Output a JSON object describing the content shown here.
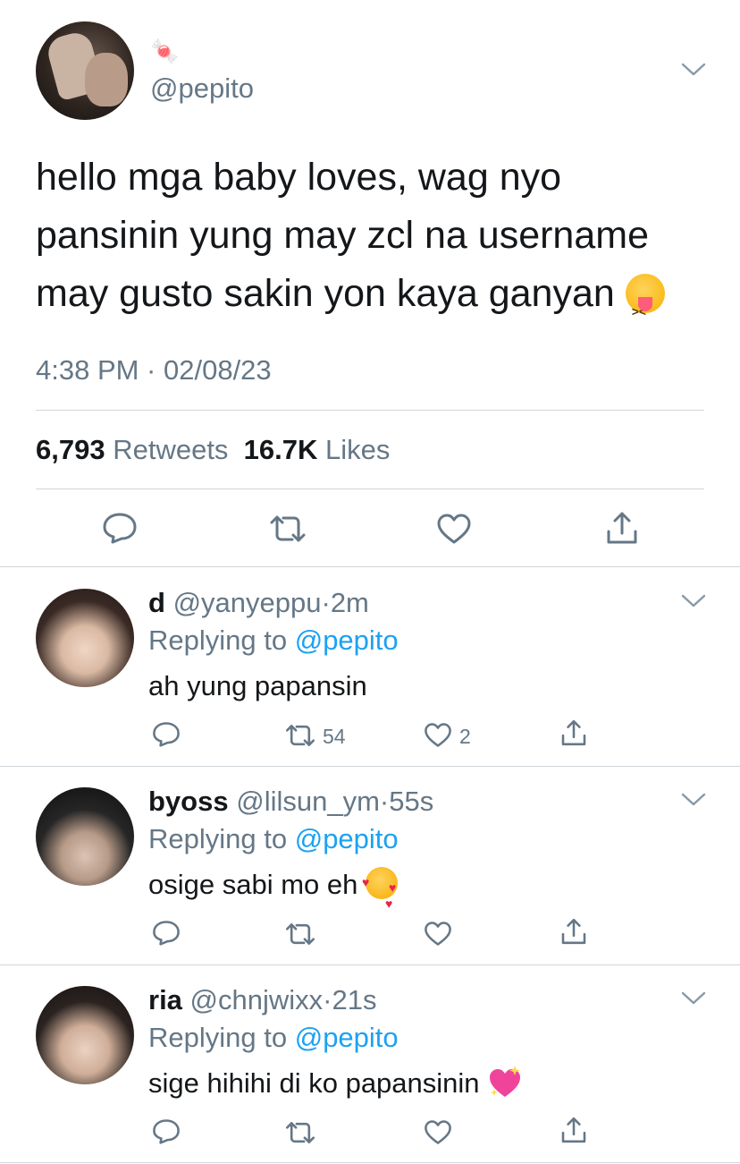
{
  "main": {
    "candy": "🍬",
    "handle": "@pepito",
    "text": "hello mga baby loves, wag nyo pansinin yung may zcl na username may gusto sakin yon kaya ganyan",
    "timestamp": "4:38 PM · 02/08/23",
    "retweet_count": "6,793",
    "retweet_label": "Retweets",
    "like_count": "16.7K",
    "like_label": "Likes"
  },
  "replies": [
    {
      "name": "d",
      "handle": "@yanyeppu",
      "separator": "·",
      "time": "2m",
      "replying_prefix": "Replying to",
      "replying_handle": "@pepito",
      "text": "ah yung papansin",
      "retweets": "54",
      "likes": "2"
    },
    {
      "name": "byoss",
      "handle": "@lilsun_ym",
      "separator": "·",
      "time": "55s",
      "replying_prefix": "Replying to",
      "replying_handle": "@pepito",
      "text": "osige sabi mo eh",
      "retweets": "",
      "likes": ""
    },
    {
      "name": "ria",
      "handle": "@chnjwixx",
      "separator": "·",
      "time": "21s",
      "replying_prefix": "Replying to",
      "replying_handle": "@pepito",
      "text": "sige hihihi di ko papansinin",
      "retweets": "",
      "likes": ""
    }
  ],
  "icons": {
    "reply": "reply-icon",
    "retweet": "retweet-icon",
    "like": "heart-icon",
    "share": "share-icon",
    "more": "chevron-down-icon"
  },
  "colors": {
    "text": "#14171a",
    "secondary": "#657786",
    "link": "#1da1f2",
    "divider": "#cfd6dc"
  }
}
